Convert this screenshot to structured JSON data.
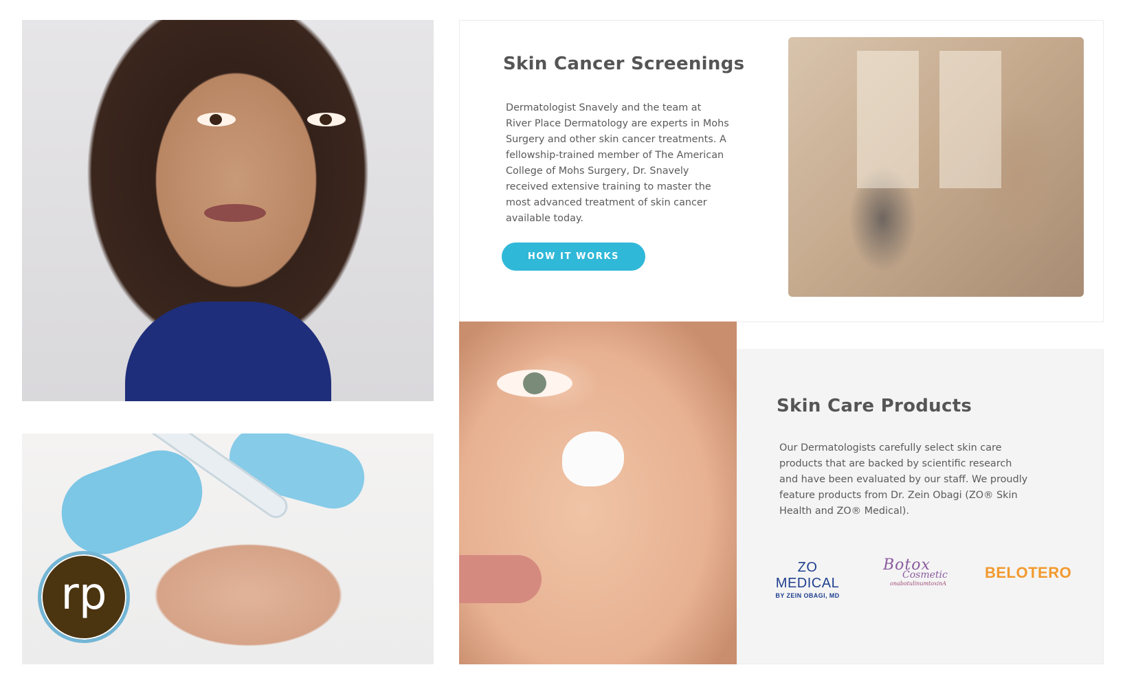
{
  "screening": {
    "heading": "Skin Cancer Screenings",
    "body": "Dermatologist Snavely and the team at River Place Dermatology are experts in Mohs Surgery and other skin cancer treatments. A fellowship-trained member of The American College of Mohs Surgery, Dr. Snavely received extensive training to master the most advanced treatment of skin cancer available today.",
    "button_label": "HOW IT WORKS"
  },
  "products": {
    "heading": "Skin Care Products",
    "body": "Our Dermatologists carefully select skin care products that are backed by scientific research and have been evaluated by our staff. We proudly feature products from Dr. Zein Obagi (ZO® Skin Health and ZO® Medical).",
    "logos": {
      "zo_main": "ZO MEDICAL",
      "zo_sub": "BY ZEIN OBAGI, MD",
      "botox_main": "Botox",
      "botox_sub": "Cosmetic",
      "botox_generic": "onabotulinumtoxinA",
      "belotero": "BELOTERO"
    }
  },
  "badge": {
    "text": "rp"
  },
  "colors": {
    "accent": "#30b8d8",
    "heading": "#555555",
    "badge_bg": "#4b3410",
    "badge_ring": "#73b6d6"
  }
}
